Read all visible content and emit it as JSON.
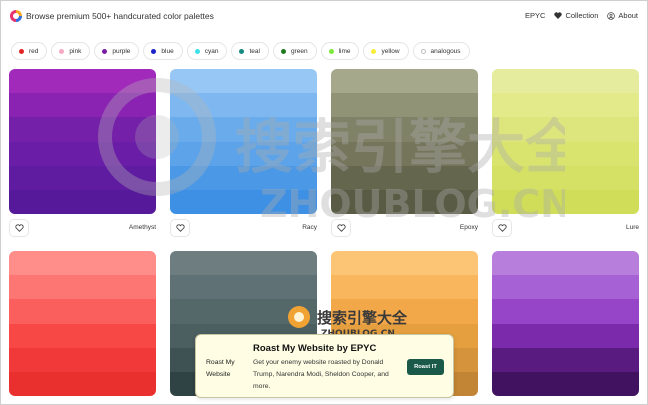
{
  "header": {
    "brand_text": "Browse premium 500+ handcurated color palettes",
    "nav": [
      {
        "label": "EPYC",
        "icon": "none"
      },
      {
        "label": "Collection",
        "icon": "heart-icon"
      },
      {
        "label": "About",
        "icon": "user-circle-icon"
      }
    ]
  },
  "filters": [
    {
      "label": "red",
      "color": "#e02424"
    },
    {
      "label": "pink",
      "color": "#f7a8c4"
    },
    {
      "label": "purple",
      "color": "#7b1fa2"
    },
    {
      "label": "blue",
      "color": "#1a23c9"
    },
    {
      "label": "cyan",
      "color": "#3ee0e8"
    },
    {
      "label": "teal",
      "color": "#178a80"
    },
    {
      "label": "green",
      "color": "#1f7a1f"
    },
    {
      "label": "lime",
      "color": "#7de83a"
    },
    {
      "label": "yellow",
      "color": "#f6ee3a"
    },
    {
      "label": "analogous",
      "color": ""
    }
  ],
  "palettes": [
    {
      "name": "Amethyst",
      "colors": [
        "#a12aba",
        "#8b23b2",
        "#7420a9",
        "#6a1ea7",
        "#601ca0",
        "#55199a"
      ]
    },
    {
      "name": "Racy",
      "colors": [
        "#97c8f5",
        "#7fb8f1",
        "#6aaceb",
        "#5ca3ea",
        "#4a98e6",
        "#3e90e4"
      ]
    },
    {
      "name": "Epoxy",
      "colors": [
        "#a6a88b",
        "#919377",
        "#808267",
        "#74755b",
        "#65664e",
        "#5a5b44"
      ]
    },
    {
      "name": "Lure",
      "colors": [
        "#e6ec9d",
        "#e2ea8a",
        "#dde67c",
        "#d9e46f",
        "#d4e164",
        "#cfdd58"
      ]
    },
    {
      "name": "",
      "colors": [
        "#ff8e8b",
        "#fd7674",
        "#fb5f5d",
        "#f84846",
        "#f2393a",
        "#e9302f"
      ]
    },
    {
      "name": "",
      "colors": [
        "#6e7d80",
        "#5f7174",
        "#546769",
        "#4b5e60",
        "#3e5254",
        "#2f4244"
      ]
    },
    {
      "name": "",
      "colors": [
        "#fcc576",
        "#f9b65c",
        "#f2a848",
        "#e59f3e",
        "#d5933b",
        "#c28435"
      ]
    },
    {
      "name": "",
      "colors": [
        "#b87edc",
        "#a662d4",
        "#9644c8",
        "#7a2aaa",
        "#5a1b80",
        "#401260"
      ]
    }
  ],
  "roast_banner": {
    "side_label": "Roast My Website",
    "title": "Roast My Website by EPYC",
    "body": "Get your enemy website roasted by Donald Trump, Narendra Modi, Sheldon Cooper, and more.",
    "button_label": "Roast IT"
  },
  "watermark": {
    "small_text": "搜索引擎大全",
    "small_sub": "ZHOUBLOG.CN",
    "large_text": "搜索引擎大全",
    "large_sub": "ZHOUBLOG.CN"
  }
}
